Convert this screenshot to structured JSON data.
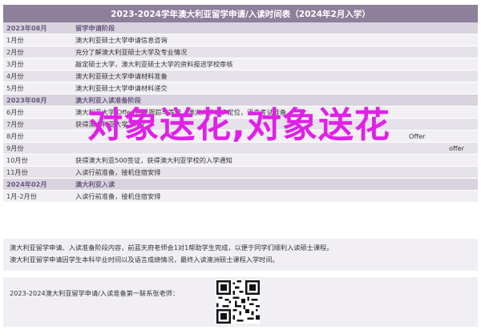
{
  "title": "2023-2024学年澳大利亚留学申请/入读时间表（2024年2月入学）",
  "sections": [
    {
      "header": {
        "date": "2023年08月",
        "text": "留学申请阶段"
      },
      "rows": [
        {
          "date": "1月份",
          "text": "澳大利亚硕士大学申请信息咨询"
        },
        {
          "date": "2月份",
          "text": "充分了解澳大利亚硕士大学及专业情况"
        },
        {
          "date": "3月份",
          "text": "敲定硕士大学，澳大利亚硕士大学的资料报送学校审核"
        },
        {
          "date": "4月份",
          "text": "澳大利亚硕士大学申请材料准备"
        },
        {
          "date": "5月份",
          "text": "澳大利亚硕士大学申请材料递交"
        }
      ]
    },
    {
      "header": {
        "date": "2023年08月",
        "text": "澳大利亚入读准备阶段"
      },
      "rows": [
        {
          "date": "6月份",
          "text": "澳大利亚大学 Offer 结果跟踪与等候，澳洲大学初步定位，语言考试准备"
        },
        {
          "date": "7月份",
          "text": "获得澳大利亚大学 offer"
        },
        {
          "date": "8月份",
          "text": "Offer"
        },
        {
          "date": "9月份",
          "text": "offer"
        },
        {
          "date": "10月份",
          "text": "获得澳大利亚500签证，获得澳大利亚学校的入学通知"
        },
        {
          "date": "11月份",
          "text": "入读行前准备，接机住宿安排"
        }
      ]
    },
    {
      "header": {
        "date": "2024年02月",
        "text": "澳大利亚入读"
      },
      "rows": [
        {
          "date": "1月-2月份",
          "text": "入读行前准备，接机住宿安排"
        }
      ]
    }
  ],
  "overlay_text": "对象送花,对象送花",
  "notes": [
    "澳大利亚留学申请、入读准备阶段内容，前蓝天府老师会1对1帮助学生完成，以便于同学们顺利入读硕士课程。",
    "澳大利亚留学申请因学生本科毕业时间以及语言成绩情况，最终入读澳洲硕士课程入学时间。"
  ],
  "footer": {
    "text": "2023-2024澳大利亚留学申请/入读准备第一联系张老师："
  },
  "qr_label": "qr-code"
}
